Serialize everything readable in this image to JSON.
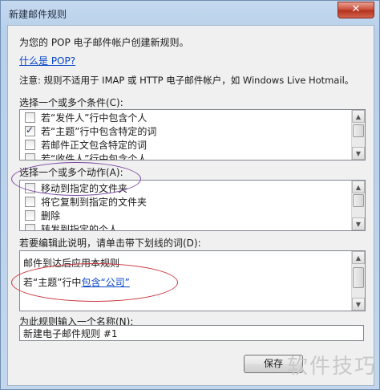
{
  "window": {
    "title": "新建邮件规则",
    "close_glyph": "✕"
  },
  "intro": "为您的 POP 电子邮件帐户创建新规则。",
  "what_is_pop_link": "什么是 POP?",
  "note": "注意: 规则不适用于 IMAP 或 HTTP 电子邮件帐户，如 Windows Live Hotmail。",
  "conditions": {
    "label": "选择一个或多个条件(C):",
    "items": [
      {
        "label": "若“发件人”行中包含个人",
        "checked": false
      },
      {
        "label": "若“主题”行中包含特定的词",
        "checked": true
      },
      {
        "label": "若邮件正文包含特定的词",
        "checked": false
      },
      {
        "label": "若“收件人”行中包含个人",
        "checked": false
      }
    ]
  },
  "actions": {
    "label": "选择一个或多个动作(A):",
    "items": [
      {
        "label": "移动到指定的文件夹",
        "checked": false
      },
      {
        "label": "将它复制到指定的文件夹",
        "checked": false
      },
      {
        "label": "删除",
        "checked": false
      },
      {
        "label": "转发到指定的个人",
        "checked": false
      }
    ]
  },
  "description": {
    "label": "若要编辑此说明，请单击带下划线的词(D):",
    "line1": "邮件到达后应用本规则",
    "line2_prefix": "若“主题”行中",
    "line2_link": "包含“公司”"
  },
  "rule_name": {
    "label": "为此规则输入一个名称(N):",
    "value": "新建电子邮件规则 #1"
  },
  "buttons": {
    "save": "保存"
  },
  "watermark": "软件技巧"
}
